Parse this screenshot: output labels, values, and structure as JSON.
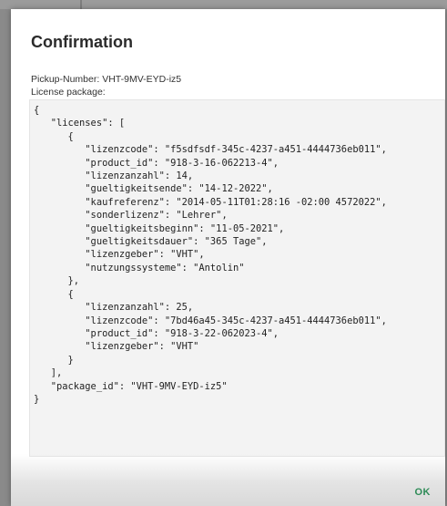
{
  "dialog": {
    "title": "Confirmation",
    "pickup_line": "Pickup-Number: VHT-9MV-EYD-iz5",
    "package_label": "License package:",
    "json_text": "{\n   \"licenses\": [\n      {\n         \"lizenzcode\": \"f5sdfsdf-345c-4237-a451-4444736eb011\",\n         \"product_id\": \"918-3-16-062213-4\",\n         \"lizenzanzahl\": 14,\n         \"gueltigkeitsende\": \"14-12-2022\",\n         \"kaufreferenz\": \"2014-05-11T01:28:16 -02:00 4572022\",\n         \"sonderlizenz\": \"Lehrer\",\n         \"gueltigkeitsbeginn\": \"11-05-2021\",\n         \"gueltigkeitsdauer\": \"365 Tage\",\n         \"lizenzgeber\": \"VHT\",\n         \"nutzungssysteme\": \"Antolin\"\n      },\n      {\n         \"lizenzanzahl\": 25,\n         \"lizenzcode\": \"7bd46a45-345c-4237-a451-4444736eb011\",\n         \"product_id\": \"918-3-22-062023-4\",\n         \"lizenzgeber\": \"VHT\"\n      }\n   ],\n   \"package_id\": \"VHT-9MV-EYD-iz5\"\n}",
    "ok_label": "OK"
  },
  "colors": {
    "backdrop": "#8a8a8a",
    "dialog_background": "#ffffff",
    "code_background": "#f3f3f3",
    "ok_accent": "#2e8b57"
  }
}
